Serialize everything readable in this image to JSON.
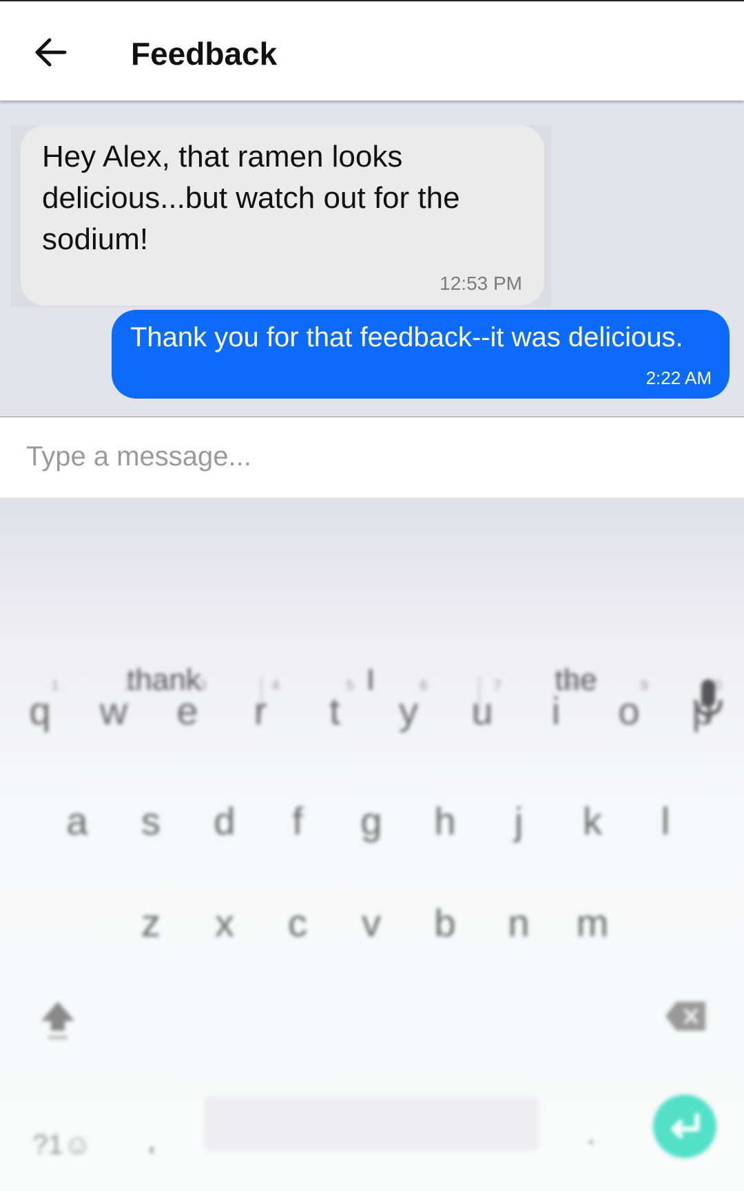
{
  "header": {
    "back_icon": "arrow-left-icon",
    "title": "Feedback"
  },
  "messages": [
    {
      "direction": "incoming",
      "text": "Hey Alex, that ramen looks delicious...but watch out for the sodium!",
      "time": "12:53 PM"
    },
    {
      "direction": "outgoing",
      "text": "Thank you for that feedback--it was delicious.",
      "time": "2:22 AM"
    }
  ],
  "composer": {
    "placeholder": "Type a message..."
  },
  "keyboard": {
    "suggestions": [
      "thank",
      "I",
      "the"
    ],
    "row1": [
      "q",
      "w",
      "e",
      "r",
      "t",
      "y",
      "u",
      "i",
      "o",
      "p"
    ],
    "row1_hints": [
      "1",
      "2",
      "3",
      "4",
      "5",
      "6",
      "7",
      "8",
      "9",
      "0"
    ],
    "row2": [
      "a",
      "s",
      "d",
      "f",
      "g",
      "h",
      "j",
      "k",
      "l"
    ],
    "row3": [
      "z",
      "x",
      "c",
      "v",
      "b",
      "n",
      "m"
    ],
    "symbols_label": "?1☺",
    "comma": ",",
    "period": ".",
    "icons": [
      "mic-icon",
      "shift-icon",
      "backspace-icon",
      "enter-icon"
    ],
    "colors": {
      "enter": "#53e0c8",
      "outgoing_bubble": "#0c6bfb",
      "incoming_bubble": "#ebebeb"
    }
  }
}
